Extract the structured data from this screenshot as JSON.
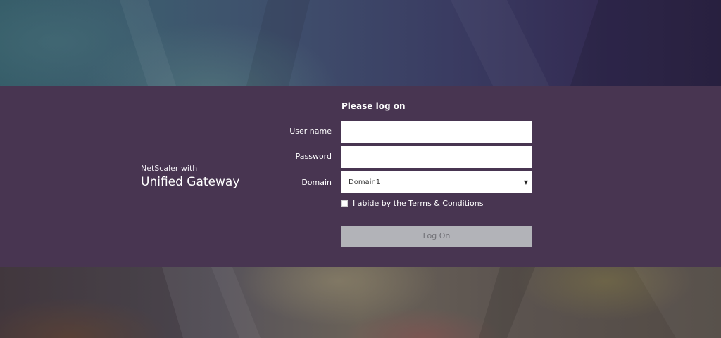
{
  "brand": {
    "line1": "NetScaler with",
    "line2": "Unified Gateway"
  },
  "form": {
    "title": "Please log on",
    "username_label": "User name",
    "username_value": "",
    "password_label": "Password",
    "password_value": "",
    "domain_label": "Domain",
    "domain_selected": "Domain1",
    "terms_label": "I abide by the Terms & Conditions",
    "terms_checked": false,
    "logon_label": "Log On"
  },
  "colors": {
    "band": "#483551",
    "button_disabled": "#b2b3b8",
    "button_text": "#6f6f74"
  },
  "icons": {
    "domain_dropdown": "caret-down-icon"
  }
}
